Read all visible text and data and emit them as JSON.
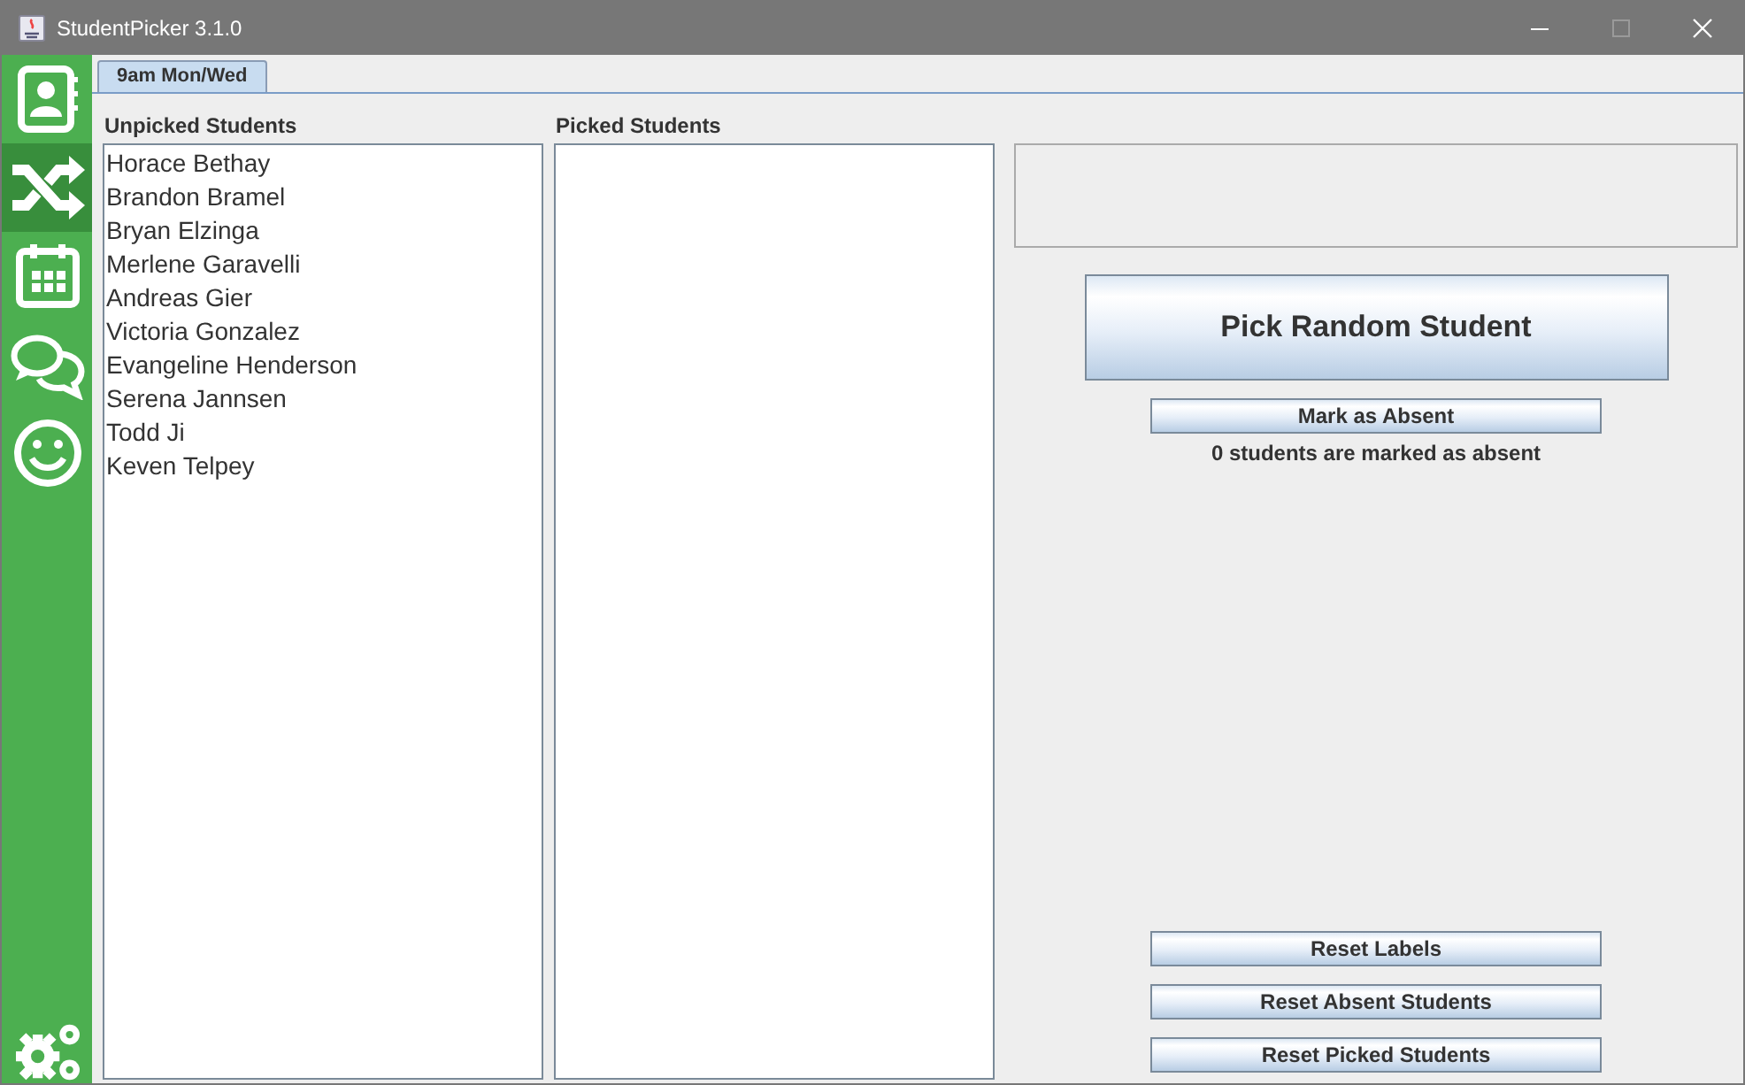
{
  "window": {
    "title": "StudentPicker 3.1.0",
    "maximize_disabled": true
  },
  "sidebar": {
    "items": [
      {
        "selected": false
      },
      {
        "selected": true
      },
      {
        "selected": false
      },
      {
        "selected": false
      },
      {
        "selected": false
      }
    ]
  },
  "tabs": [
    {
      "label": "9am Mon/Wed",
      "selected": true
    }
  ],
  "unpicked": {
    "title": "Unpicked Students",
    "students": [
      "Horace Bethay",
      "Brandon Bramel",
      "Bryan Elzinga",
      "Merlene Garavelli",
      "Andreas Gier",
      "Victoria Gonzalez",
      "Evangeline Henderson",
      "Serena Jannsen",
      "Todd Ji",
      "Keven Telpey"
    ]
  },
  "picked": {
    "title": "Picked Students"
  },
  "pick_button": "Pick Random Student",
  "absent_button": "Mark as Absent",
  "absent_status": "0 students are marked as absent",
  "reset_buttons": [
    "Reset Labels",
    "Reset Absent Students",
    "Reset Picked Students"
  ]
}
